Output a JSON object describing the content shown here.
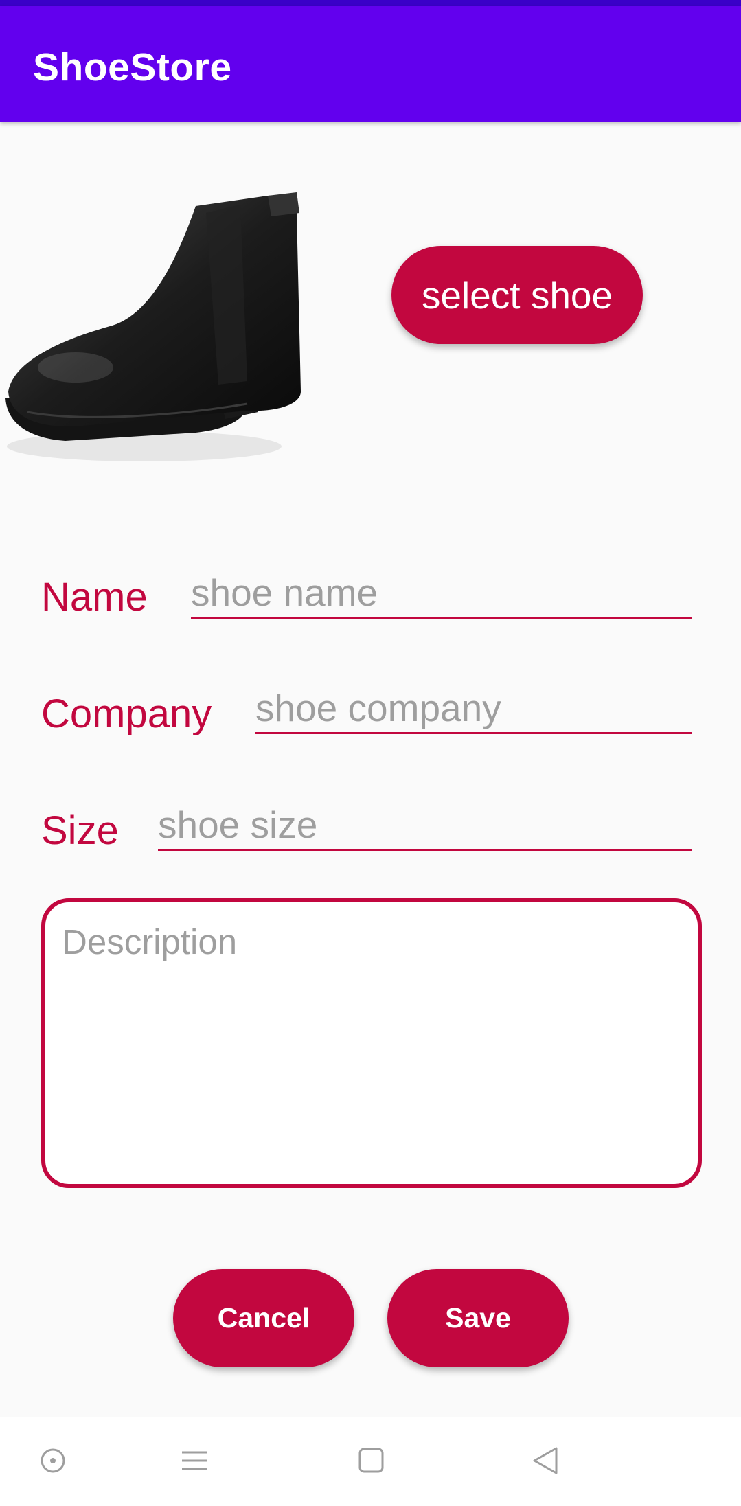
{
  "app": {
    "title": "ShoeStore"
  },
  "image": {
    "icon": "shoe-boot-image"
  },
  "buttons": {
    "select_shoe": "select shoe",
    "cancel": "Cancel",
    "save": "Save"
  },
  "form": {
    "name": {
      "label": "Name",
      "placeholder": "shoe name"
    },
    "company": {
      "label": "Company",
      "placeholder": "shoe company"
    },
    "size": {
      "label": "Size",
      "placeholder": "shoe size"
    },
    "description": {
      "placeholder": "Description"
    }
  },
  "nav": {
    "icons": [
      "record-icon",
      "menu-icon",
      "home-square-icon",
      "back-triangle-icon"
    ]
  },
  "colors": {
    "app_bar": "#6200ee",
    "status_strip": "#3a00c8",
    "accent": "#c2073f",
    "hint": "#9e9e9e",
    "background": "#fafafa"
  }
}
